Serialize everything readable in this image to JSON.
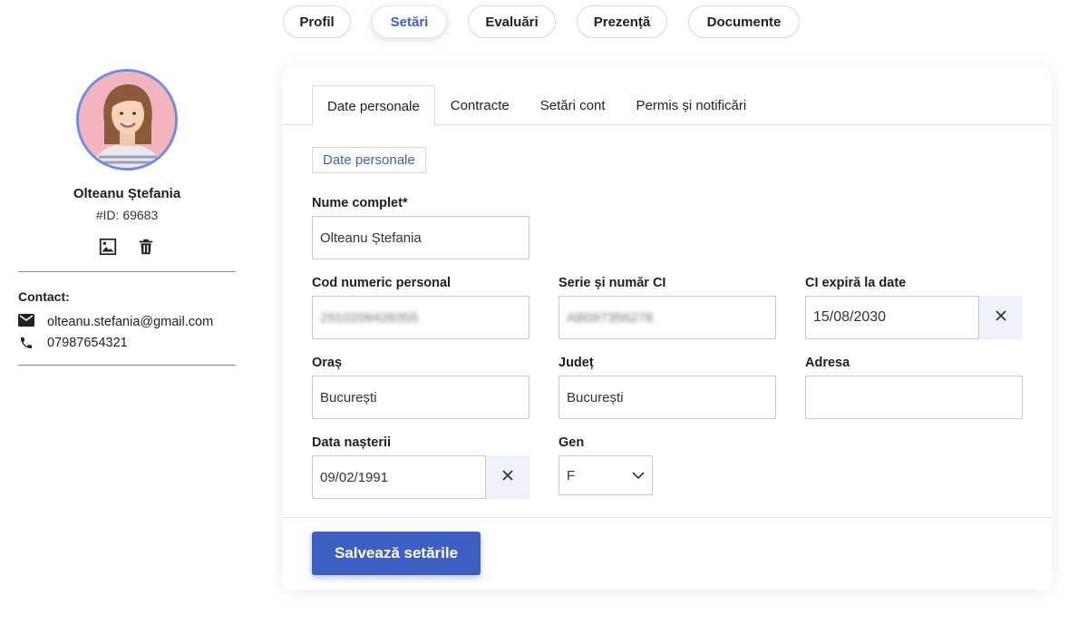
{
  "top_tabs": [
    {
      "label": "Profil",
      "active": false
    },
    {
      "label": "Setări",
      "active": true
    },
    {
      "label": "Evaluări",
      "active": false
    },
    {
      "label": "Prezență",
      "active": false
    },
    {
      "label": "Documente",
      "active": false
    }
  ],
  "profile": {
    "name": "Olteanu Ștefania",
    "id": "#ID: 69683",
    "contact_title": "Contact:",
    "email": "olteanu.stefania@gmail.com",
    "phone": "07987654321"
  },
  "inner_tabs": [
    {
      "label": "Date personale",
      "active": true
    },
    {
      "label": "Contracte",
      "active": false
    },
    {
      "label": "Setări cont",
      "active": false
    },
    {
      "label": "Permis și notificări",
      "active": false
    }
  ],
  "section_title": "Date personale",
  "form": {
    "full_name": {
      "label": "Nume complet*",
      "value": "Olteanu Ștefania"
    },
    "cnp": {
      "label": "Cod numeric personal",
      "value": "2910209426355"
    },
    "ci_series": {
      "label": "Serie și număr CI",
      "value": "AB097356278"
    },
    "ci_expiry": {
      "label": "CI expiră la date",
      "value": "15/08/2030"
    },
    "city": {
      "label": "Oraș",
      "value": "București"
    },
    "county": {
      "label": "Județ",
      "value": "București"
    },
    "address": {
      "label": "Adresa",
      "value": ""
    },
    "birth_date": {
      "label": "Data nașterii",
      "value": "09/02/1991"
    },
    "gender": {
      "label": "Gen",
      "value": "F"
    }
  },
  "save_label": "Salvează setările",
  "colors": {
    "accent": "#3d5fc4",
    "avatar_border": "#6f8ee0",
    "clear_bg": "#eef2f8"
  },
  "icons": {
    "image": "image-icon",
    "delete": "trash-icon",
    "email": "mail-icon",
    "phone": "phone-icon",
    "clear": "close-icon",
    "dropdown": "chevron-down-icon"
  }
}
